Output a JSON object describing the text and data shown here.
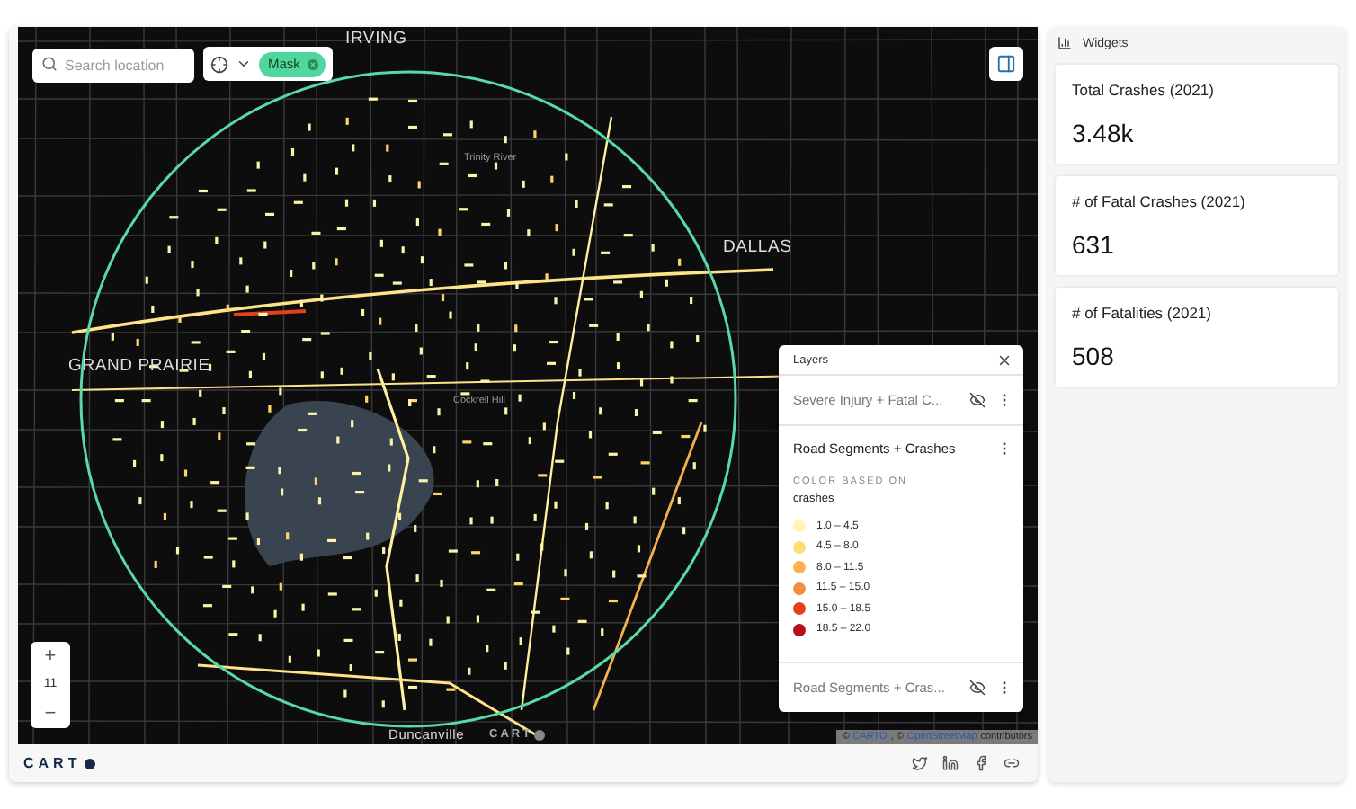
{
  "map": {
    "search": {
      "placeholder": "Search location"
    },
    "mask_chip": "Mask",
    "labels": [
      {
        "text": "IRVING",
        "kind": "city"
      },
      {
        "text": "DALLAS",
        "kind": "city"
      },
      {
        "text": "GRAND PRAIRIE",
        "kind": "city"
      },
      {
        "text": "Trinity River",
        "kind": "minor"
      },
      {
        "text": "Cockrell Hill",
        "kind": "minor"
      },
      {
        "text": "Duncanville",
        "kind": "town"
      }
    ],
    "zoom": {
      "plus": "+",
      "level": "11",
      "minus": "−"
    },
    "attribution": {
      "prefix": "©",
      "carto": "CARTO",
      "sep": ", ©",
      "osm": "OpenStreetMap",
      "suffix": "contributors"
    },
    "map_logo": "CART"
  },
  "layers_panel": {
    "title": "Layers",
    "layers": [
      {
        "name": "Severe Injury + Fatal C...",
        "kind": "collapsed",
        "visible": false
      },
      {
        "name": "Road Segments + Crashes",
        "kind": "expanded",
        "visible": true,
        "legend": {
          "heading": "COLOR BASED ON",
          "field": "crashes",
          "items": [
            {
              "label": "1.0 – 4.5",
              "color": "#fef6b5"
            },
            {
              "label": "4.5 – 8.0",
              "color": "#ffdd71"
            },
            {
              "label": "8.0 – 11.5",
              "color": "#ffb14e"
            },
            {
              "label": "11.5 – 15.0",
              "color": "#f68d3a"
            },
            {
              "label": "15.0 – 18.5",
              "color": "#e5401c"
            },
            {
              "label": "18.5 – 22.0",
              "color": "#b5101f"
            }
          ]
        }
      },
      {
        "name": "Road Segments + Cras...",
        "kind": "collapsed",
        "visible": false
      }
    ]
  },
  "footer": {
    "logo": "CART"
  },
  "widgets": {
    "title": "Widgets",
    "cards": [
      {
        "label": "Total Crashes (2021)",
        "value": "3.48k"
      },
      {
        "label": "# of Fatal Crashes (2021)",
        "value": "631"
      },
      {
        "label": "# of Fatalities (2021)",
        "value": "508"
      }
    ]
  }
}
